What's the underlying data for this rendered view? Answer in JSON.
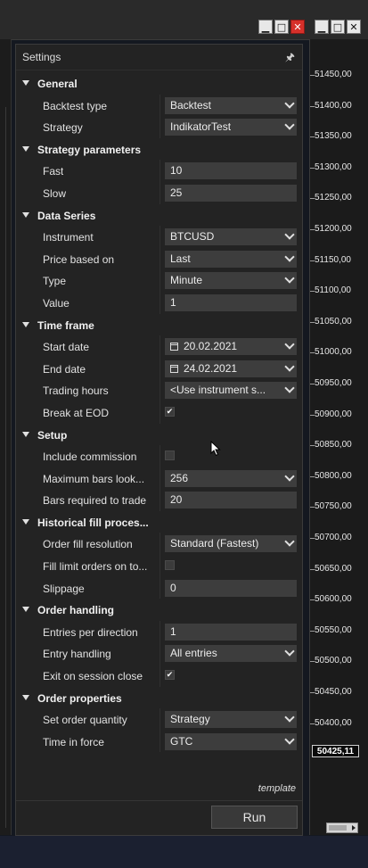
{
  "window": {
    "pin_icon": "pin-icon"
  },
  "settings": {
    "title": "Settings",
    "template_label": "template",
    "run_label": "Run",
    "rows": [
      {
        "kind": "category",
        "label": "General"
      },
      {
        "kind": "select",
        "label": "Backtest type",
        "value": "Backtest"
      },
      {
        "kind": "select",
        "label": "Strategy",
        "value": "IndikatorTest"
      },
      {
        "kind": "category",
        "label": "Strategy parameters"
      },
      {
        "kind": "input",
        "label": "Fast",
        "value": "10"
      },
      {
        "kind": "input",
        "label": "Slow",
        "value": "25"
      },
      {
        "kind": "category",
        "label": "Data Series"
      },
      {
        "kind": "select",
        "label": "Instrument",
        "value": "BTCUSD"
      },
      {
        "kind": "select",
        "label": "Price based on",
        "value": "Last"
      },
      {
        "kind": "select",
        "label": "Type",
        "value": "Minute"
      },
      {
        "kind": "input",
        "label": "Value",
        "value": "1"
      },
      {
        "kind": "category",
        "label": "Time frame"
      },
      {
        "kind": "date",
        "label": "Start date",
        "value": "20.02.2021"
      },
      {
        "kind": "date",
        "label": "End date",
        "value": "24.02.2021"
      },
      {
        "kind": "select",
        "label": "Trading hours",
        "value": "<Use instrument s..."
      },
      {
        "kind": "check",
        "label": "Break at EOD",
        "checked": true
      },
      {
        "kind": "category",
        "label": "Setup"
      },
      {
        "kind": "check",
        "label": "Include commission",
        "checked": false
      },
      {
        "kind": "select",
        "label": "Maximum bars look...",
        "value": "256"
      },
      {
        "kind": "input",
        "label": "Bars required to trade",
        "value": "20"
      },
      {
        "kind": "category",
        "label": "Historical fill proces..."
      },
      {
        "kind": "select",
        "label": "Order fill resolution",
        "value": "Standard (Fastest)"
      },
      {
        "kind": "check",
        "label": "Fill limit orders on to...",
        "checked": false
      },
      {
        "kind": "input",
        "label": "Slippage",
        "value": "0"
      },
      {
        "kind": "category",
        "label": "Order handling"
      },
      {
        "kind": "input",
        "label": "Entries per direction",
        "value": "1"
      },
      {
        "kind": "select",
        "label": "Entry handling",
        "value": "All entries"
      },
      {
        "kind": "check",
        "label": "Exit on session close",
        "checked": true
      },
      {
        "kind": "category",
        "label": "Order properties"
      },
      {
        "kind": "select",
        "label": "Set order quantity",
        "value": "Strategy"
      },
      {
        "kind": "select",
        "label": "Time in force",
        "value": "GTC"
      }
    ]
  },
  "price_axis": {
    "labels": [
      "51450,00",
      "51400,00",
      "51350,00",
      "51300,00",
      "51250,00",
      "51200,00",
      "51150,00",
      "51100,00",
      "51050,00",
      "51000,00",
      "50950,00",
      "50900,00",
      "50850,00",
      "50800,00",
      "50750,00",
      "50700,00",
      "50650,00",
      "50600,00",
      "50550,00",
      "50500,00",
      "50450,00",
      "50400,00"
    ],
    "current_price": "50425,11"
  }
}
